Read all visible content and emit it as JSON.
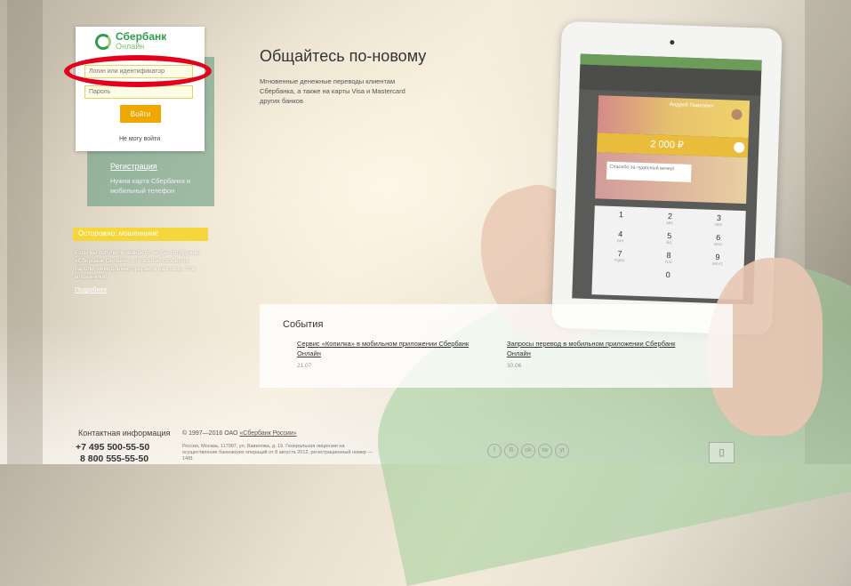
{
  "login": {
    "logo_text": "Сбербанк",
    "logo_sub": "Онлайн",
    "login_placeholder": "Логин или идентификатор",
    "password_placeholder": "Пароль",
    "submit_label": "Войти",
    "forgot_label": "Не могу войти",
    "register_label": "Регистрация",
    "register_hint": "Нужна карта Сбербанка и мобильный телефон"
  },
  "caution": {
    "title": "Осторожно: мошенники!",
    "text": "Если вы получили звонок от якобы сотрудника «Сбербанк Онлайн» с просьбой сообщить пароли, немедленно прервите разговор. Это мошенники!",
    "more_label": "Подробнее"
  },
  "hero": {
    "title": "Общайтесь по-новому",
    "subtitle": "Мгновенные денежные переводы клиентам Сбербанка, а также на карты Visa и Mastercard других банков"
  },
  "tablet": {
    "recipient": "Андрей Павлович",
    "amount": "2 000 ₽",
    "message": "Спасибо за чудесный вечер!",
    "keys": [
      {
        "d": "1",
        "l": ""
      },
      {
        "d": "2",
        "l": "ABC"
      },
      {
        "d": "3",
        "l": "DEF"
      },
      {
        "d": "4",
        "l": "GHI"
      },
      {
        "d": "5",
        "l": "JKL"
      },
      {
        "d": "6",
        "l": "MNO"
      },
      {
        "d": "7",
        "l": "PQRS"
      },
      {
        "d": "8",
        "l": "TUV"
      },
      {
        "d": "9",
        "l": "WXYZ"
      },
      {
        "d": "0",
        "l": ""
      }
    ]
  },
  "events": {
    "title": "События",
    "items": [
      {
        "text": "Сервис «Копилка» в мобильном приложении Сбербанк Онлайн",
        "date": "21.07"
      },
      {
        "text": "Запросы перевод в мобильном приложении Сбербанк Онлайн",
        "date": "30.06"
      }
    ]
  },
  "footer": {
    "contacts_label": "Контактная информация",
    "phone1": "+7 495 500-55-50",
    "phone2": "8 800 555-55-50",
    "copyright_prefix": "© 1997—2016 ОАО ",
    "copyright_link": "«Сбербанк России»",
    "license": "Россия, Москва, 117997, ул. Вавилова, д. 19. Генеральная лицензия на осуществление банковских операций от 8 августа 2012, регистрационный номер — 1481",
    "socials": [
      "f",
      "В",
      "ok",
      "tw",
      "yt"
    ],
    "mobile_icon": "▯"
  },
  "colors": {
    "brand_green": "#2e9d4a",
    "accent_yellow": "#f0a800",
    "highlight_red": "#e4001b"
  }
}
